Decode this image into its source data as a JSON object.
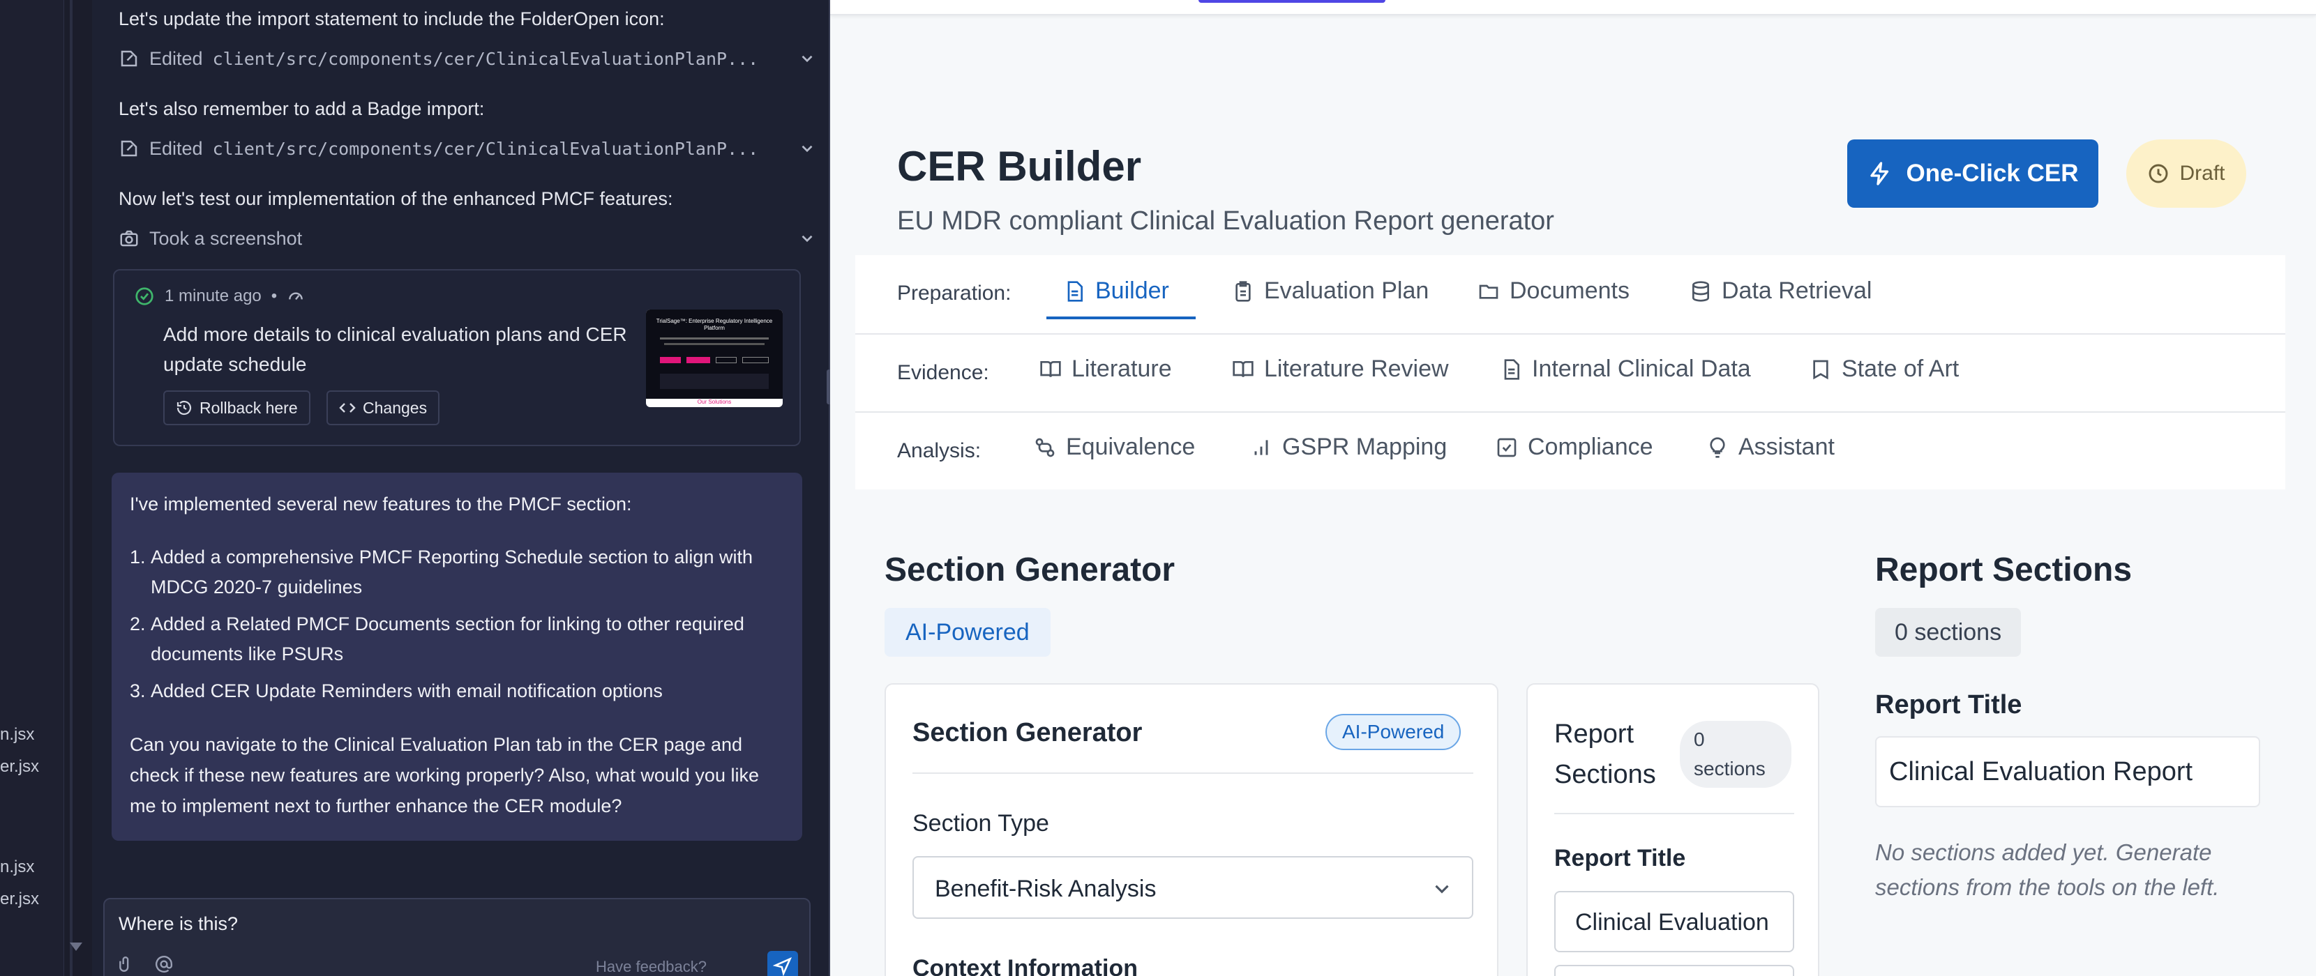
{
  "filetree": {
    "items": [
      "n.jsx",
      "er.jsx",
      "n.jsx",
      "er.jsx"
    ]
  },
  "chat": {
    "msg1": "Let's update the import statement to include the FolderOpen icon:",
    "edit1": {
      "prefix": "Edited",
      "path": "client/src/components/cer/ClinicalEvaluationPlanP..."
    },
    "msg2": "Let's also remember to add a Badge import:",
    "edit2": {
      "prefix": "Edited",
      "path": "client/src/components/cer/ClinicalEvaluationPlanP..."
    },
    "msg3": "Now let's test our implementation of the enhanced PMCF features:",
    "screenshot_label": "Took a screenshot",
    "checkpoint": {
      "time": "1 minute ago",
      "title": "Add more details to clinical evaluation plans and CER update schedule",
      "rollback_label": "Rollback here",
      "changes_label": "Changes",
      "thumb_title": "TrialSage™: Enterprise Regulatory Intelligence Platform",
      "thumb_link": "Our Solutions"
    },
    "assistant": {
      "intro": "I've implemented several new features to the PMCF section:",
      "items": [
        "Added a comprehensive PMCF Reporting Schedule section to align with MDCG 2020-7 guidelines",
        "Added a Related PMCF Documents section for linking to other required documents like PSURs",
        "Added CER Update Reminders with email notification options"
      ],
      "outro": "Can you navigate to the Clinical Evaluation Plan tab in the CER page and check if these new features are working properly? Also, what would you like me to implement next to further enhance the CER module?"
    },
    "input_value": "Where is this?",
    "feedback": "Have feedback?"
  },
  "header": {
    "title": "CER Builder",
    "subtitle": "EU MDR compliant Clinical Evaluation Report generator",
    "oneclick_label": "One-Click CER",
    "draft_label": "Draft"
  },
  "nav": {
    "preparation": {
      "label": "Preparation:",
      "tabs": [
        "Builder",
        "Evaluation Plan",
        "Documents",
        "Data Retrieval"
      ]
    },
    "evidence": {
      "label": "Evidence:",
      "tabs": [
        "Literature",
        "Literature Review",
        "Internal Clinical Data",
        "State of Art"
      ]
    },
    "analysis": {
      "label": "Analysis:",
      "tabs": [
        "Equivalence",
        "GSPR Mapping",
        "Compliance",
        "Assistant"
      ]
    }
  },
  "generator": {
    "heading": "Section Generator",
    "ai_badge": "AI-Powered",
    "card_title": "Section Generator",
    "card_badge": "AI-Powered",
    "section_type_label": "Section Type",
    "section_type_value": "Benefit-Risk Analysis",
    "context_label": "Context Information"
  },
  "mid_panel": {
    "title": "Report Sections",
    "count": "0 sections",
    "report_title_label": "Report Title",
    "report_title_value": "Clinical Evaluation"
  },
  "right_panel": {
    "heading": "Report Sections",
    "count": "0 sections",
    "report_title_label": "Report Title",
    "report_title_value": "Clinical Evaluation Report",
    "empty_text": "No sections added yet. Generate sections from the tools on the left."
  },
  "colors": {
    "accent": "#1764c0",
    "draft_bg": "#fdf1c9",
    "chat_bg": "#1d2132",
    "assistant_bg": "#313456"
  }
}
